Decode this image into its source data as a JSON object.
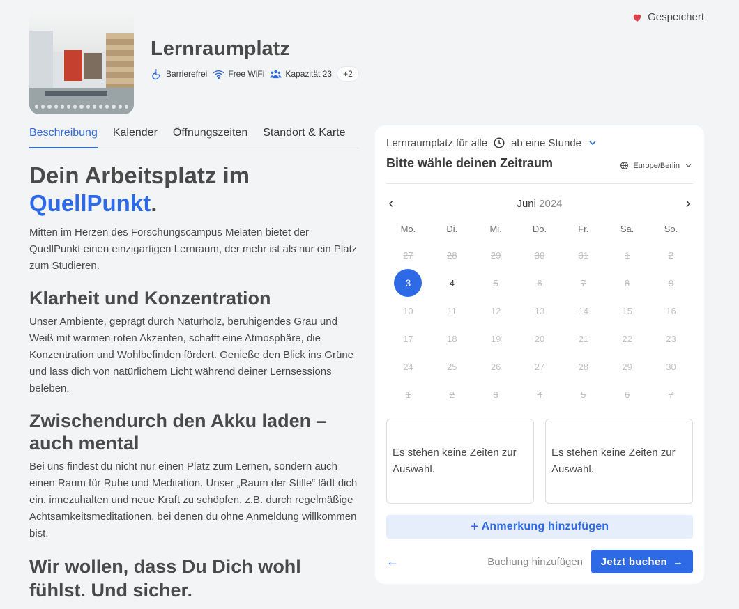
{
  "header": {
    "saved_label": "Gespeichert",
    "title": "Lernraumplatz",
    "features": [
      "Barrierefrei",
      "Free WiFi",
      "Kapazität 23"
    ],
    "more_badge": "+2"
  },
  "tabs": [
    "Beschreibung",
    "Kalender",
    "Öffnungszeiten",
    "Standort & Karte"
  ],
  "content": {
    "h1_part1": "Dein Arbeitsplatz im",
    "h1_highlight": "QuellPunkt",
    "h1_end": ".",
    "intro": "Mitten im Herzen des Forschungscampus Melaten bietet der QuellPunkt einen einzigartigen Lernraum, der mehr ist als nur ein Platz zum Studieren.",
    "h2_1": "Klarheit und Konzentration",
    "p_1": "Unser Ambiente, geprägt durch Naturholz, beruhigendes Grau und Weiß mit warmen roten Akzenten, schafft eine Atmosphäre, die Konzentration und Wohlbefinden fördert. Genieße den Blick ins Grüne und lass dich von natürlichem Licht während deiner Lernsessions beleben.",
    "h2_2": "Zwischendurch den Akku laden – auch mental",
    "p_2": "Bei uns findest du nicht nur einen Platz zum Lernen, sondern auch einen Raum für Ruhe und Meditation. Unser „Raum der Stille“ lädt dich ein, innezuhalten und neue Kraft zu schöpfen, z.B. durch regelmäßige Achtsamkeitsmeditationen, bei denen du ohne Anmeldung willkommen bist.",
    "h2_3": "Wir wollen, dass Du Dich wohl fühlst. Und sicher."
  },
  "booking": {
    "offer_label": "Lernraumplatz für alle",
    "duration_label": "ab eine Stunde",
    "subtitle": "Bitte wähle deinen Zeitraum",
    "timezone": "Europe/Berlin",
    "month": "Juni",
    "year": "2024",
    "weekdays": [
      "Mo.",
      "Di.",
      "Mi.",
      "Do.",
      "Fr.",
      "Sa.",
      "So."
    ],
    "days": [
      {
        "d": "27",
        "s": "off"
      },
      {
        "d": "28",
        "s": "off"
      },
      {
        "d": "29",
        "s": "off"
      },
      {
        "d": "30",
        "s": "off"
      },
      {
        "d": "31",
        "s": "off"
      },
      {
        "d": "1",
        "s": "off"
      },
      {
        "d": "2",
        "s": "off"
      },
      {
        "d": "3",
        "s": "sel"
      },
      {
        "d": "4",
        "s": "avail"
      },
      {
        "d": "5",
        "s": "off"
      },
      {
        "d": "6",
        "s": "off"
      },
      {
        "d": "7",
        "s": "off"
      },
      {
        "d": "8",
        "s": "off"
      },
      {
        "d": "9",
        "s": "off"
      },
      {
        "d": "10",
        "s": "off"
      },
      {
        "d": "11",
        "s": "off"
      },
      {
        "d": "12",
        "s": "off"
      },
      {
        "d": "13",
        "s": "off"
      },
      {
        "d": "14",
        "s": "off"
      },
      {
        "d": "15",
        "s": "off"
      },
      {
        "d": "16",
        "s": "off"
      },
      {
        "d": "17",
        "s": "off"
      },
      {
        "d": "18",
        "s": "off"
      },
      {
        "d": "19",
        "s": "off"
      },
      {
        "d": "20",
        "s": "off"
      },
      {
        "d": "21",
        "s": "off"
      },
      {
        "d": "22",
        "s": "off"
      },
      {
        "d": "23",
        "s": "off"
      },
      {
        "d": "24",
        "s": "off"
      },
      {
        "d": "25",
        "s": "off"
      },
      {
        "d": "26",
        "s": "off"
      },
      {
        "d": "27",
        "s": "off"
      },
      {
        "d": "28",
        "s": "off"
      },
      {
        "d": "29",
        "s": "off"
      },
      {
        "d": "30",
        "s": "off"
      },
      {
        "d": "1",
        "s": "off"
      },
      {
        "d": "2",
        "s": "off"
      },
      {
        "d": "3",
        "s": "off"
      },
      {
        "d": "4",
        "s": "off"
      },
      {
        "d": "5",
        "s": "off"
      },
      {
        "d": "6",
        "s": "off"
      },
      {
        "d": "7",
        "s": "off"
      }
    ],
    "no_slots_1": "Es stehen keine Zeiten zur Auswahl.",
    "no_slots_2": "Es stehen keine Zeiten zur Auswahl.",
    "add_note": "Anmerkung hinzufügen",
    "add_booking": "Buchung hinzufügen",
    "book_now": "Jetzt buchen"
  },
  "colors": {
    "accent": "#2f6ae6",
    "heart": "#d9434b",
    "page_bg": "#f3f4f6"
  }
}
